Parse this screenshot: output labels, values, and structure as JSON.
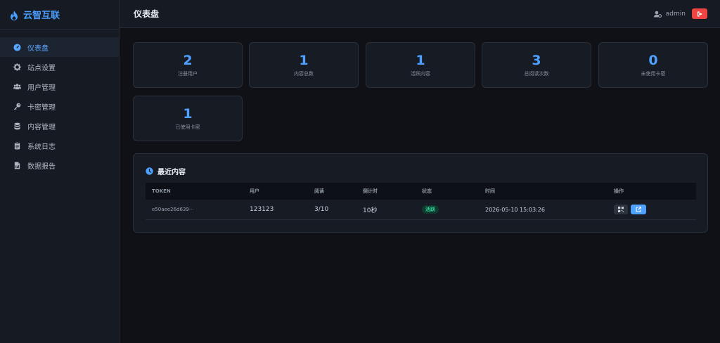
{
  "app": {
    "name": "云智互联",
    "brand_color": "#4a9eff"
  },
  "sidebar": {
    "items": [
      {
        "label": "仪表盘",
        "icon": "dashboard-icon",
        "active": true
      },
      {
        "label": "站点设置",
        "icon": "gear-icon",
        "active": false
      },
      {
        "label": "用户管理",
        "icon": "users-icon",
        "active": false
      },
      {
        "label": "卡密管理",
        "icon": "key-icon",
        "active": false
      },
      {
        "label": "内容管理",
        "icon": "database-icon",
        "active": false
      },
      {
        "label": "系统日志",
        "icon": "clipboard-icon",
        "active": false
      },
      {
        "label": "数据报告",
        "icon": "file-icon",
        "active": false
      }
    ]
  },
  "header": {
    "title": "仪表盘",
    "username": "admin"
  },
  "stats": [
    {
      "value": "2",
      "label": "注册用户"
    },
    {
      "value": "1",
      "label": "内容总数"
    },
    {
      "value": "1",
      "label": "活跃内容"
    },
    {
      "value": "3",
      "label": "总阅读次数"
    },
    {
      "value": "0",
      "label": "未使用卡密"
    },
    {
      "value": "1",
      "label": "已使用卡密"
    }
  ],
  "recent": {
    "title": "最近内容",
    "columns": [
      "TOKEN",
      "用户",
      "阅读",
      "倒计时",
      "状态",
      "时间",
      "操作"
    ],
    "rows": [
      {
        "token": "e50aee26d639···",
        "user": "123123",
        "reads": "3/10",
        "countdown": "10秒",
        "status": "活跃",
        "time": "2026-05-10 15:03:26"
      }
    ]
  },
  "colors": {
    "accent": "#4ea1ff",
    "danger": "#ef4444",
    "success": "#34d399",
    "background": "#0f1117",
    "panel": "#161b24"
  }
}
